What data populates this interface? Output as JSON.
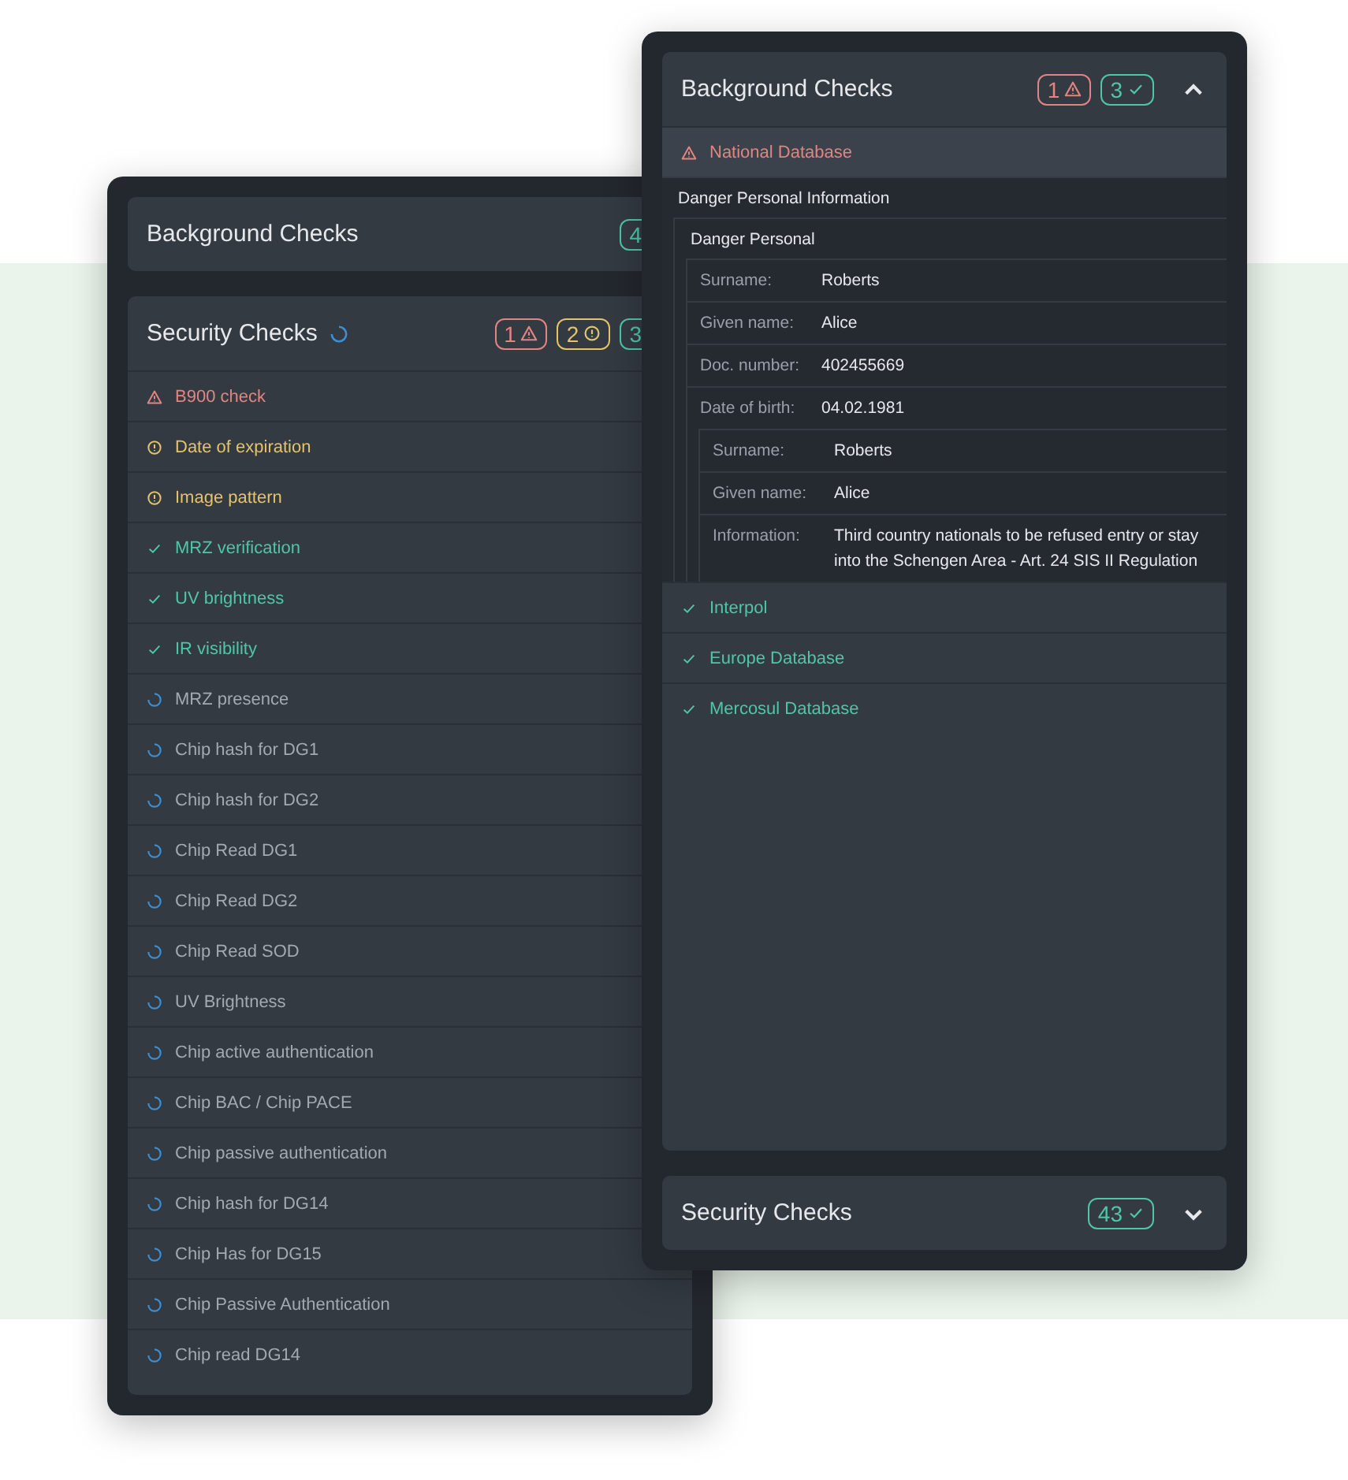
{
  "panels": [
    {
      "cards": [
        {
          "title": "Background Checks",
          "badges": [
            {
              "kind": "pass",
              "count": "4"
            }
          ]
        },
        {
          "title": "Security Checks",
          "loading": true,
          "badges": [
            {
              "kind": "fail",
              "count": "1"
            },
            {
              "kind": "warning",
              "count": "2"
            },
            {
              "kind": "pass",
              "count": "3"
            }
          ],
          "items": [
            {
              "kind": "fail",
              "label": "B900 check"
            },
            {
              "kind": "warning",
              "label": "Date of expiration"
            },
            {
              "kind": "warning",
              "label": "Image pattern"
            },
            {
              "kind": "pass",
              "label": "MRZ verification"
            },
            {
              "kind": "pass",
              "label": "UV brightness"
            },
            {
              "kind": "pass",
              "label": "IR visibility"
            },
            {
              "kind": "pending",
              "label": "MRZ presence"
            },
            {
              "kind": "pending",
              "label": "Chip hash for DG1"
            },
            {
              "kind": "pending",
              "label": "Chip hash for DG2"
            },
            {
              "kind": "pending",
              "label": "Chip Read DG1"
            },
            {
              "kind": "pending",
              "label": "Chip Read DG2"
            },
            {
              "kind": "pending",
              "label": "Chip Read SOD"
            },
            {
              "kind": "pending",
              "label": "UV Brightness"
            },
            {
              "kind": "pending",
              "label": "Chip active authentication"
            },
            {
              "kind": "pending",
              "label": "Chip BAC / Chip PACE"
            },
            {
              "kind": "pending",
              "label": "Chip passive authentication"
            },
            {
              "kind": "pending",
              "label": "Chip hash for DG14"
            },
            {
              "kind": "pending",
              "label": "Chip Has for DG15"
            },
            {
              "kind": "pending",
              "label": "Chip Passive Authentication"
            },
            {
              "kind": "pending",
              "label": "Chip read DG14"
            }
          ]
        }
      ]
    },
    {
      "cards": [
        {
          "title": "Background Checks",
          "expanded": true,
          "badges": [
            {
              "kind": "fail",
              "count": "1"
            },
            {
              "kind": "pass",
              "count": "3"
            }
          ],
          "items": [
            {
              "kind": "fail",
              "label": "National Database",
              "expanded": true,
              "details": {
                "title": "Danger Personal Information",
                "children": [
                  {
                    "title": "Danger Personal",
                    "fields": [
                      {
                        "label": "Surname:",
                        "value": "Roberts"
                      },
                      {
                        "label": "Given name:",
                        "value": "Alice"
                      },
                      {
                        "label": "Doc. number:",
                        "value": "402455669"
                      },
                      {
                        "label": "Date of birth:",
                        "value": "04.02.1981"
                      }
                    ],
                    "children": [
                      {
                        "fields": [
                          {
                            "label": "Surname:",
                            "value": "Roberts"
                          },
                          {
                            "label": "Given name:",
                            "value": "Alice"
                          },
                          {
                            "label": "Information:",
                            "value": "Third country nationals to be refused entry or stay into the Schengen Area - Art. 24 SIS II Regulation"
                          }
                        ]
                      }
                    ]
                  }
                ]
              }
            },
            {
              "kind": "pass",
              "label": "Interpol",
              "expanded": false
            },
            {
              "kind": "pass",
              "label": "Europe Database",
              "expanded": false
            },
            {
              "kind": "pass",
              "label": "Mercosul Database",
              "expanded": false
            }
          ]
        },
        {
          "title": "Security Checks",
          "expanded": false,
          "badges": [
            {
              "kind": "pass",
              "count": "43"
            }
          ]
        }
      ]
    }
  ]
}
